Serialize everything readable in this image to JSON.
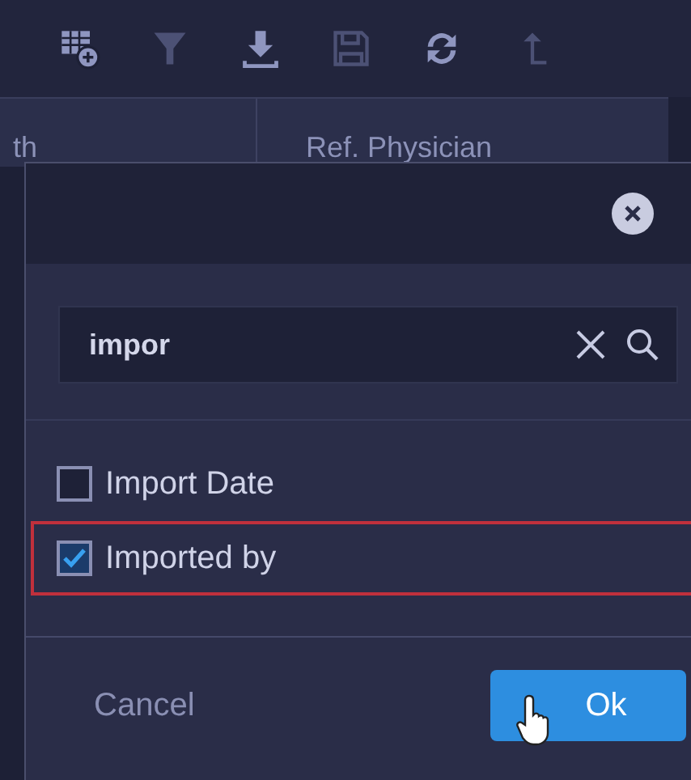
{
  "toolbar": {
    "buttons": [
      {
        "kind": "add-table",
        "disabled": false
      },
      {
        "kind": "filter",
        "disabled": true
      },
      {
        "kind": "download",
        "disabled": false
      },
      {
        "kind": "save",
        "disabled": true
      },
      {
        "kind": "refresh",
        "disabled": false
      },
      {
        "kind": "upload",
        "disabled": true
      }
    ]
  },
  "table": {
    "columns": [
      "th",
      "Ref. Physician"
    ]
  },
  "dialog": {
    "search": {
      "value": "impor"
    },
    "options": [
      {
        "label": "Import Date",
        "checked": false,
        "highlighted": false
      },
      {
        "label": "Imported by",
        "checked": true,
        "highlighted": true
      }
    ],
    "buttons": [
      {
        "label": "Cancel",
        "kind": "secondary"
      },
      {
        "label": "Ok",
        "kind": "primary"
      }
    ]
  }
}
